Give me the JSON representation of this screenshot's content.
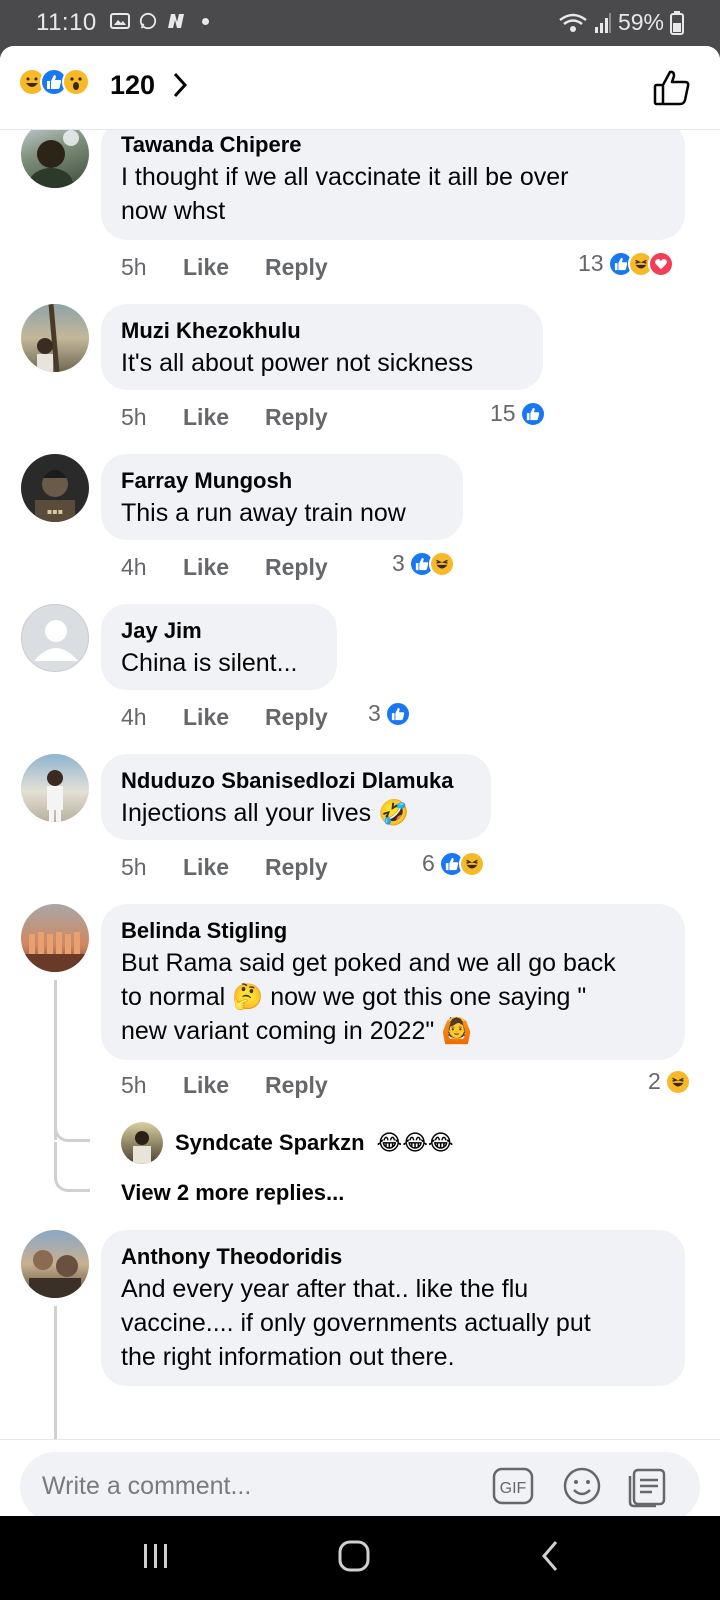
{
  "status_bar": {
    "time": "11:10",
    "battery": "59%"
  },
  "header": {
    "reaction_count": "120",
    "reaction_icons": [
      "haha-icon",
      "like-icon",
      "wow-icon"
    ]
  },
  "comments": [
    {
      "name": "Tawanda Chipere",
      "text_lines": [
        "I thought if we all vaccinate  it aill be  over",
        "now whst"
      ],
      "time": "5h",
      "like": "Like",
      "reply": "Reply",
      "reaction_count": "13",
      "reactions": [
        "like",
        "haha",
        "love"
      ]
    },
    {
      "name": "Muzi Khezokhulu",
      "text_lines": [
        "It's all about power not sickness"
      ],
      "time": "5h",
      "like": "Like",
      "reply": "Reply",
      "reaction_count": "15",
      "reactions": [
        "like"
      ]
    },
    {
      "name": "Farray Mungosh",
      "text_lines": [
        "This a run away train now"
      ],
      "time": "4h",
      "like": "Like",
      "reply": "Reply",
      "reaction_count": "3",
      "reactions": [
        "like",
        "haha"
      ]
    },
    {
      "name": "Jay Jim",
      "text_lines": [
        "China is silent..."
      ],
      "time": "4h",
      "like": "Like",
      "reply": "Reply",
      "reaction_count": "3",
      "reactions": [
        "like"
      ]
    },
    {
      "name": "Nduduzo Sbanisedlozi Dlamuka",
      "text_lines": [
        "Injections all your lives 🤣"
      ],
      "time": "5h",
      "like": "Like",
      "reply": "Reply",
      "reaction_count": "6",
      "reactions": [
        "like",
        "haha"
      ]
    },
    {
      "name": "Belinda Stigling",
      "text_lines": [
        "But Rama said get poked and we all go back",
        "to normal 🤔 now we got this one saying \"",
        "new variant coming in 2022\" 🙆"
      ],
      "time": "5h",
      "like": "Like",
      "reply": "Reply",
      "reaction_count": "2",
      "reactions": [
        "haha"
      ]
    },
    {
      "name": "Anthony Theodoridis",
      "text_lines": [
        "And every year after that..    like the flu",
        "vaccine.... if only governments actually put",
        "the right information out there."
      ]
    }
  ],
  "reply_preview": {
    "name": "Syndcate Sparkzn",
    "emojis": "😂😂😂"
  },
  "more_replies": "View 2 more replies...",
  "composer": {
    "placeholder": "Write a comment...",
    "gif_label": "GIF"
  },
  "colors": {
    "like_blue": "#1877f2",
    "haha_yellow": "#f7b928",
    "love_red": "#f33e58",
    "bubble_gray": "#f0f2f5",
    "meta_gray": "#65676b"
  }
}
